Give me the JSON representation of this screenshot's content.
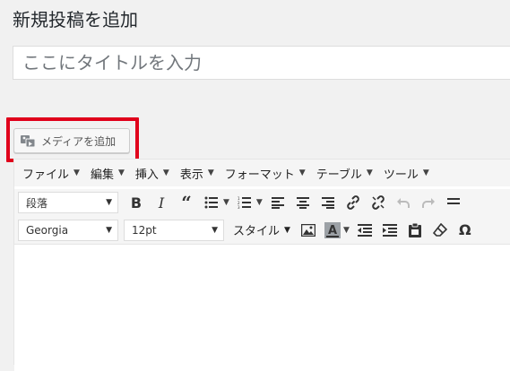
{
  "page": {
    "title": "新規投稿を追加",
    "title_placeholder": "ここにタイトルを入力"
  },
  "media": {
    "button_label": "メディアを追加"
  },
  "editor": {
    "menubar": [
      "ファイル",
      "編集",
      "挿入",
      "表示",
      "フォーマット",
      "テーブル",
      "ツール"
    ],
    "format_select": "段落",
    "font_select": "Georgia",
    "size_select": "12pt",
    "styles_label": "スタイル"
  },
  "colors": {
    "highlight": "#e0001b",
    "background": "#f1f1f1"
  }
}
